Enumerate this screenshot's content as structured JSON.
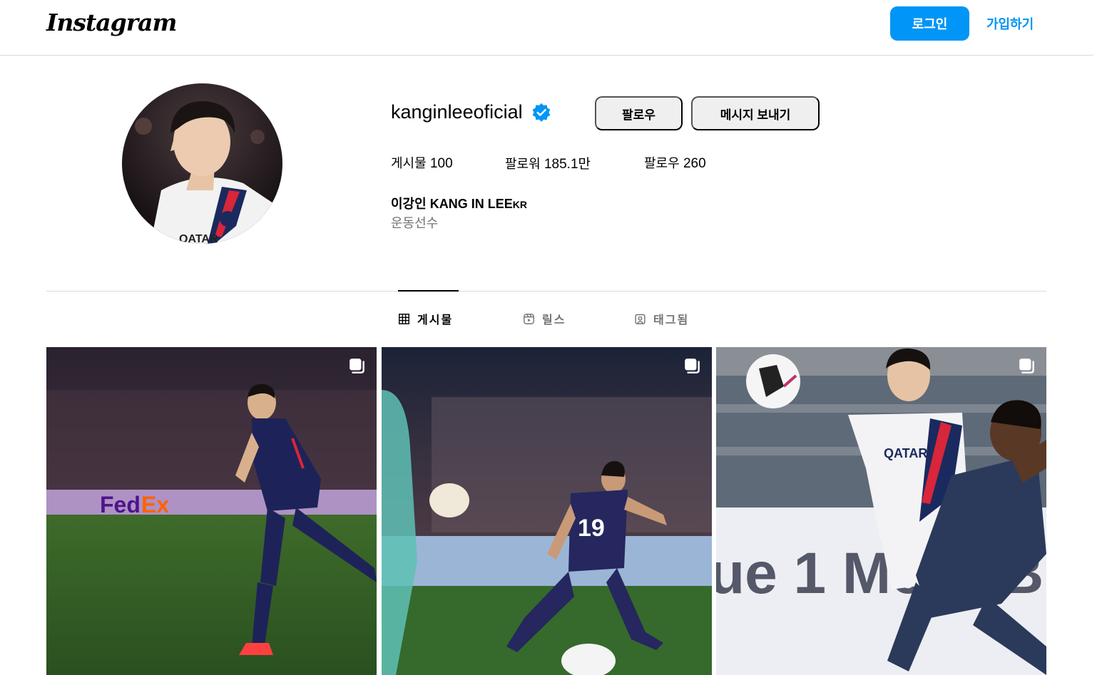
{
  "topbar": {
    "logo": "Instagram",
    "login_label": "로그인",
    "signup_label": "가입하기"
  },
  "profile": {
    "username": "kanginleeoficial",
    "verified": true,
    "follow_label": "팔로우",
    "message_label": "메시지 보내기",
    "stats": {
      "posts_label": "게시물",
      "posts_value": "100",
      "followers_label": "팔로워",
      "followers_value": "185.1만",
      "following_label": "팔로우",
      "following_value": "260"
    },
    "name_kr": "이강인",
    "name_en": "KANG IN LEE",
    "flag": "KR",
    "category": "운동선수"
  },
  "tabs": [
    {
      "label": "게시물",
      "icon": "grid-icon",
      "active": true
    },
    {
      "label": "릴스",
      "icon": "reels-icon",
      "active": false
    },
    {
      "label": "태그됨",
      "icon": "tagged-icon",
      "active": false
    }
  ],
  "posts": [
    {
      "type": "carousel",
      "icon": "multi-post-icon"
    },
    {
      "type": "carousel",
      "icon": "multi-post-icon"
    },
    {
      "type": "carousel",
      "icon": "multi-post-icon"
    }
  ],
  "colors": {
    "accent": "#0095f6",
    "button_gray": "#efefef",
    "border": "#dbdbdb",
    "secondary_text": "#737373",
    "verified_badge": "#0095f6"
  }
}
